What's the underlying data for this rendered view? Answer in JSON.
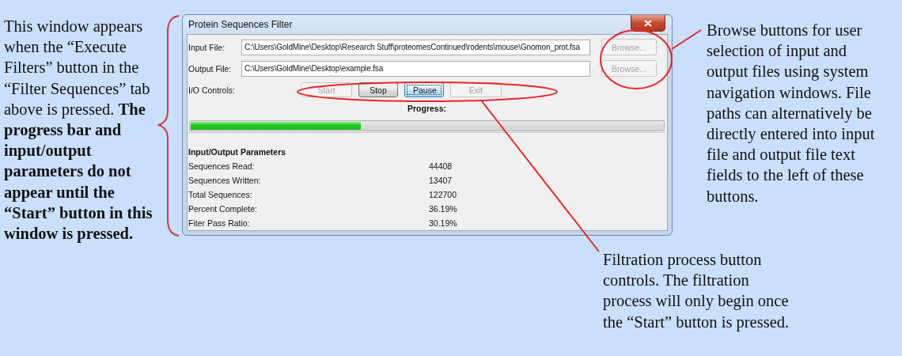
{
  "notes": {
    "window_note": "This window appears when the “Execute Filters” button in the “Filter Sequences” tab above is pressed. **The progress bar and input/output parameters do not appear until the “Start” button in this window is pressed.**",
    "browse_note": "Browse buttons for user selection of input and output files using system navigation windows. File paths can alternatively be directly entered into input file and output file text fields to the left of these buttons.",
    "controls_note": "Filtration process button controls. The filtration process will only begin once the “Start” button is pressed."
  },
  "window": {
    "title": "Protein Sequences Filter",
    "fields": [
      {
        "label": "Input File:",
        "value": "C:\\Users\\GoldMine\\Desktop\\Research Stuff\\proteomesContinued\\rodents\\mouse\\Gnomon_prot.fsa",
        "browse": {
          "label": "Browse...",
          "disabled": true
        }
      },
      {
        "label": "Output File:",
        "value": "C:\\Users\\GoldMine\\Desktop\\example.fsa",
        "browse": {
          "label": "Browse...",
          "disabled": true
        }
      }
    ],
    "controls": {
      "label": "I/O Controls:",
      "buttons": [
        {
          "label": "Start",
          "disabled": true,
          "focused": false
        },
        {
          "label": "Stop",
          "disabled": false,
          "focused": false
        },
        {
          "label": "Pause",
          "disabled": false,
          "focused": true
        },
        {
          "label": "Exit",
          "disabled": true,
          "focused": false
        }
      ]
    },
    "progress": {
      "label": "Progress:",
      "level": 0.36
    },
    "parameters": {
      "heading": "Input/Output Parameters",
      "rows": [
        {
          "label": "Sequences Read:",
          "value": "44408"
        },
        {
          "label": "Sequences Written:",
          "value": "13407"
        },
        {
          "label": "Total Sequences:",
          "value": "122700"
        },
        {
          "label": "Percent Complete:",
          "value": "36.19%"
        },
        {
          "label": "Fiter Pass Ratio:",
          "value": "30.19%"
        }
      ]
    }
  }
}
